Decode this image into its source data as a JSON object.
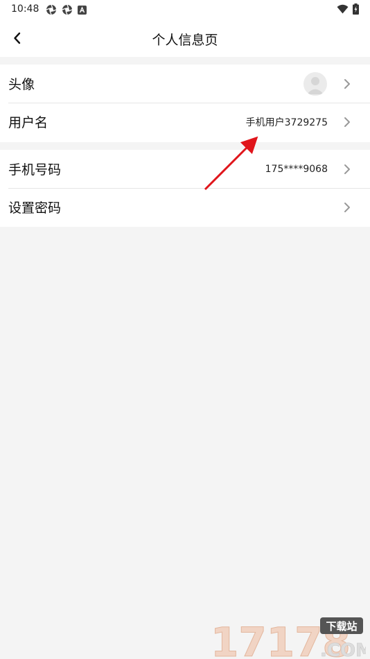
{
  "status": {
    "time": "10:48"
  },
  "header": {
    "title": "个人信息页"
  },
  "rows": [
    {
      "label": "头像",
      "value": ""
    },
    {
      "label": "用户名",
      "value": "手机用户3729275"
    },
    {
      "label": "手机号码",
      "value": "175****9068"
    },
    {
      "label": "设置密码",
      "value": ""
    }
  ],
  "colors": {
    "annotation_arrow": "#e0151b",
    "background": "#f4f4f4"
  },
  "watermark": {
    "main": "17178",
    "badge": "下载站",
    "suffix": ".COM"
  }
}
